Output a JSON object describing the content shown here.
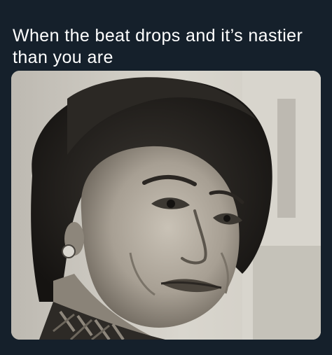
{
  "tweet": {
    "text": "When the beat drops and it’s nastier than you are"
  },
  "media": {
    "kind": "photo",
    "style": "black-and-white",
    "colors": {
      "background": "#15202b",
      "text": "#ffffff"
    }
  }
}
